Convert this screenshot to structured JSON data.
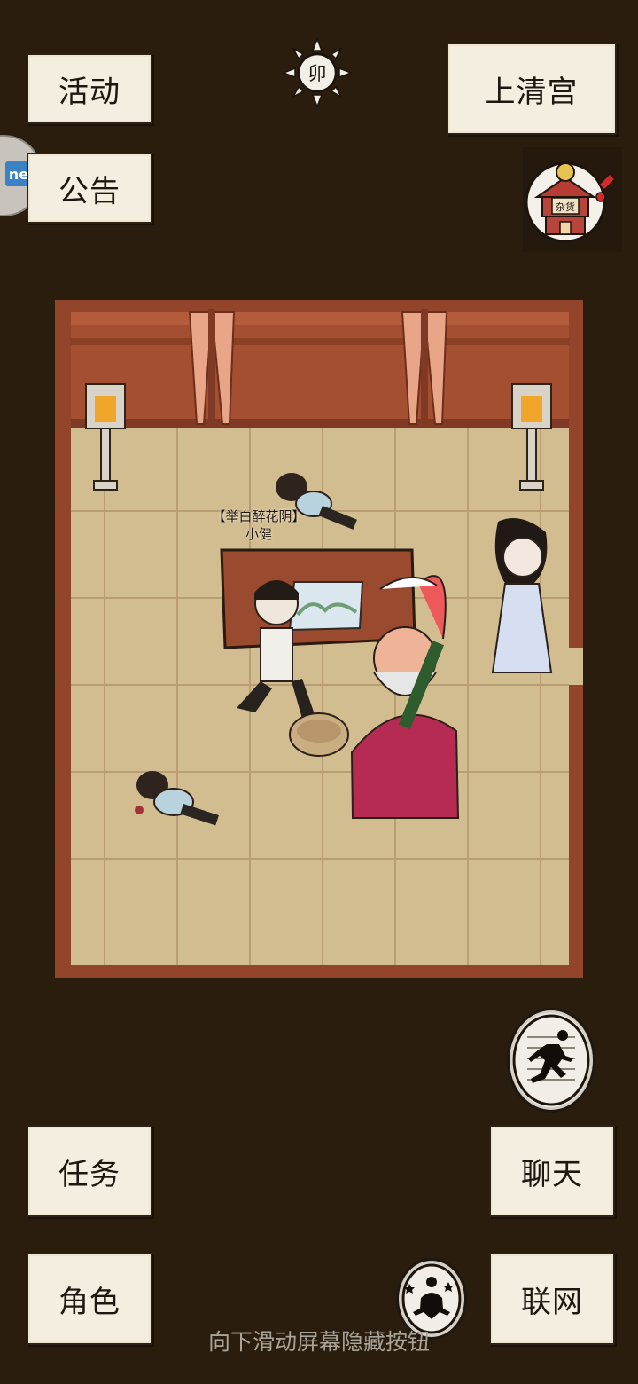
{
  "top_left_buttons": {
    "activity_label": "活动",
    "notice_label": "公告"
  },
  "top_right": {
    "location_label": "上清宫",
    "shop_sign": "杂货"
  },
  "time_indicator": {
    "hour_char": "卯"
  },
  "map": {
    "player_title": "【举白醉花阴】",
    "player_name": "小健"
  },
  "bottom_buttons": {
    "task_label": "任务",
    "role_label": "角色",
    "chat_label": "聊天",
    "net_label": "联网"
  },
  "hint_text": "向下滑动屏幕隐藏按钮",
  "icons": {
    "time": "sun-icon",
    "shop": "general-store-icon",
    "run": "run-icon",
    "meditate": "meditate-icon"
  },
  "colors": {
    "background": "#2a1d0e",
    "button_bg": "#f3eedf",
    "floor": "#d0b98e",
    "wall": "#9d4d31",
    "alert": "#d22b2b"
  }
}
